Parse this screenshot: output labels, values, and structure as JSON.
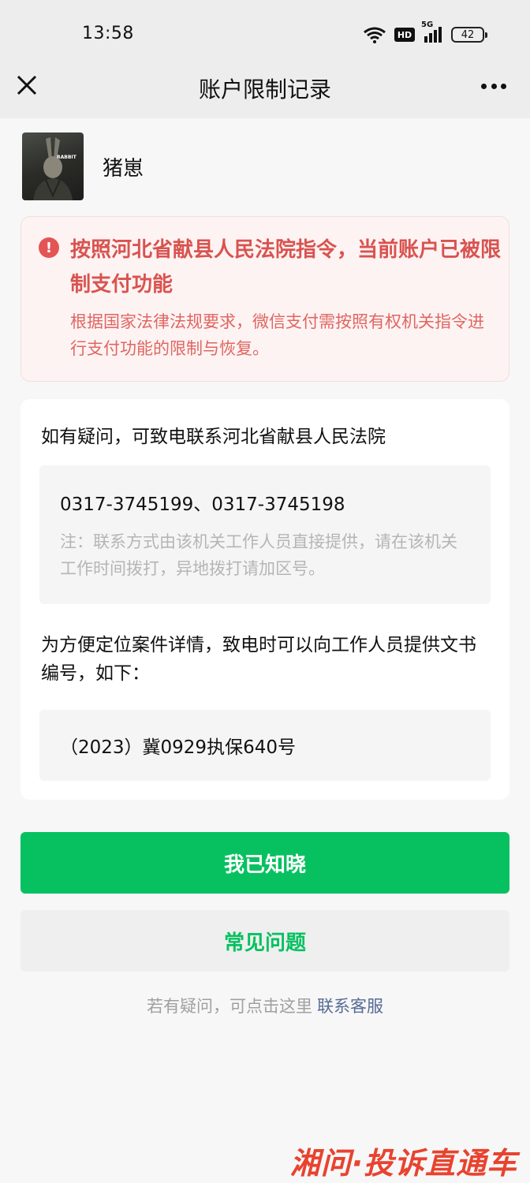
{
  "status_bar": {
    "time": "13:58",
    "network_label": "5G",
    "hd_label": "HD",
    "battery": "42"
  },
  "nav": {
    "title": "账户限制记录"
  },
  "account": {
    "name": "猪崽",
    "avatar_text": "RABBIT"
  },
  "alert": {
    "title": "按照河北省献县人民法院指令，当前账户已被限制支付功能",
    "description": "根据国家法律法规要求，微信支付需按照有权机关指令进行支付功能的限制与恢复。",
    "color": "#d9534f"
  },
  "info": {
    "intro": "如有疑问，可致电联系河北省献县人民法院",
    "phone_numbers": "0317-3745199、0317-3745198",
    "note": "注：联系方式由该机关工作人员直接提供，请在该机关工作时间拨打，异地拨打请加区号。",
    "doc_prompt": "为方便定位案件详情，致电时可以向工作人员提供文书编号，如下：",
    "doc_number": "（2023）冀0929执保640号"
  },
  "buttons": {
    "primary": "我已知晓",
    "secondary": "常见问题",
    "primary_color": "#07c160"
  },
  "footer": {
    "text": "若有疑问，可点击这里",
    "link": "联系客服"
  },
  "watermark": {
    "text": "湘问·投诉直通车"
  }
}
